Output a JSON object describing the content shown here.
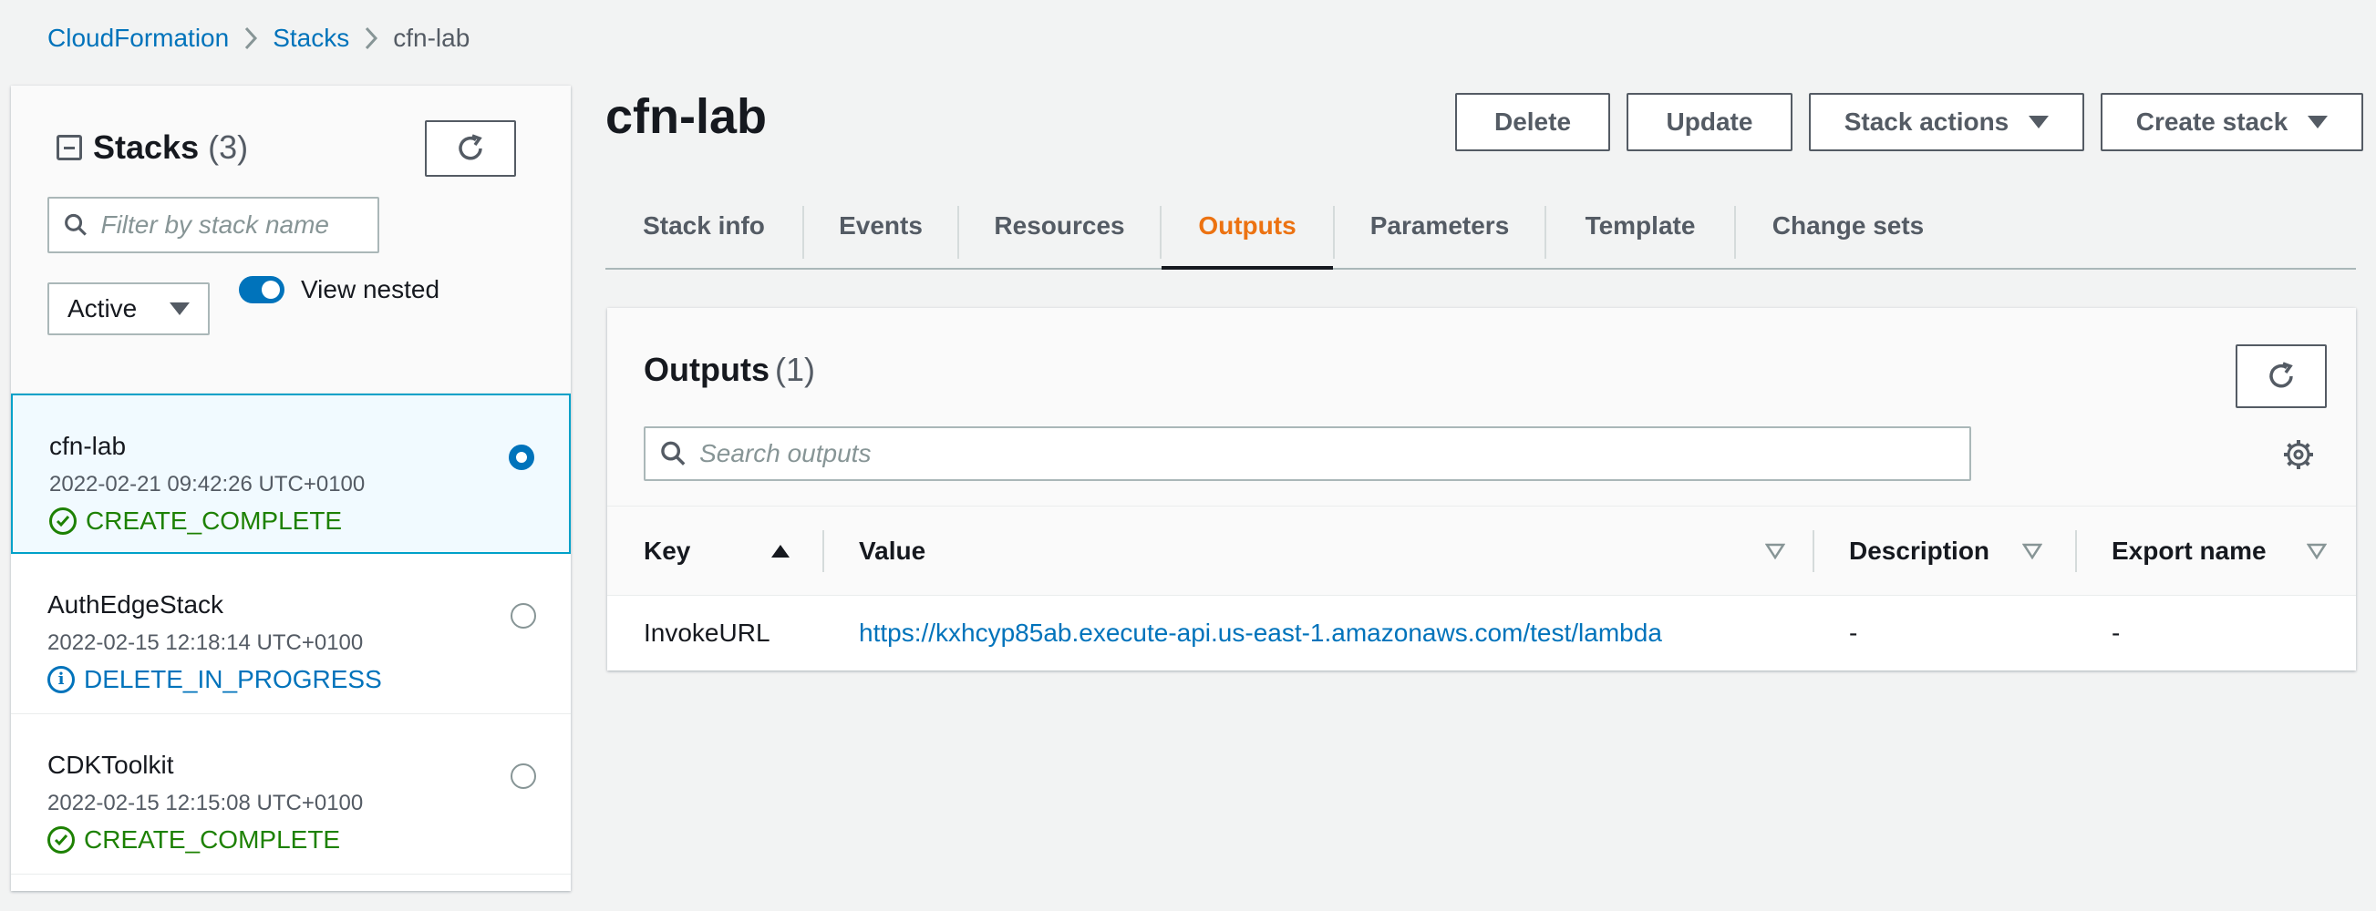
{
  "breadcrumb": {
    "items": [
      "CloudFormation",
      "Stacks"
    ],
    "current": "cfn-lab"
  },
  "sidebar": {
    "title": "Stacks",
    "count": "(3)",
    "filter_placeholder": "Filter by stack name",
    "status_filter": "Active",
    "view_nested_label": "View nested",
    "view_nested_on": true,
    "page": "1",
    "stacks": [
      {
        "name": "cfn-lab",
        "date": "2022-02-21 09:42:26 UTC+0100",
        "status": "CREATE_COMPLETE",
        "status_type": "success",
        "selected": true
      },
      {
        "name": "AuthEdgeStack",
        "date": "2022-02-15 12:18:14 UTC+0100",
        "status": "DELETE_IN_PROGRESS",
        "status_type": "info",
        "selected": false
      },
      {
        "name": "CDKToolkit",
        "date": "2022-02-15 12:15:08 UTC+0100",
        "status": "CREATE_COMPLETE",
        "status_type": "success",
        "selected": false
      }
    ]
  },
  "main": {
    "title": "cfn-lab",
    "buttons": {
      "delete": "Delete",
      "update": "Update",
      "stack_actions": "Stack actions",
      "create_stack": "Create stack"
    },
    "tabs": [
      "Stack info",
      "Events",
      "Resources",
      "Outputs",
      "Parameters",
      "Template",
      "Change sets"
    ],
    "active_tab": "Outputs"
  },
  "outputs": {
    "title": "Outputs",
    "count": "(1)",
    "search_placeholder": "Search outputs",
    "columns": [
      "Key",
      "Value",
      "Description",
      "Export name"
    ],
    "rows": [
      {
        "key": "InvokeURL",
        "value": "https://kxhcyp85ab.execute-api.us-east-1.amazonaws.com/test/lambda",
        "description": "-",
        "export_name": "-"
      }
    ]
  },
  "colors": {
    "link": "#0073bb",
    "active_tab": "#ec7211",
    "success": "#1d8102",
    "selected_bg": "#f1faff",
    "selected_border": "#00a1c9"
  }
}
